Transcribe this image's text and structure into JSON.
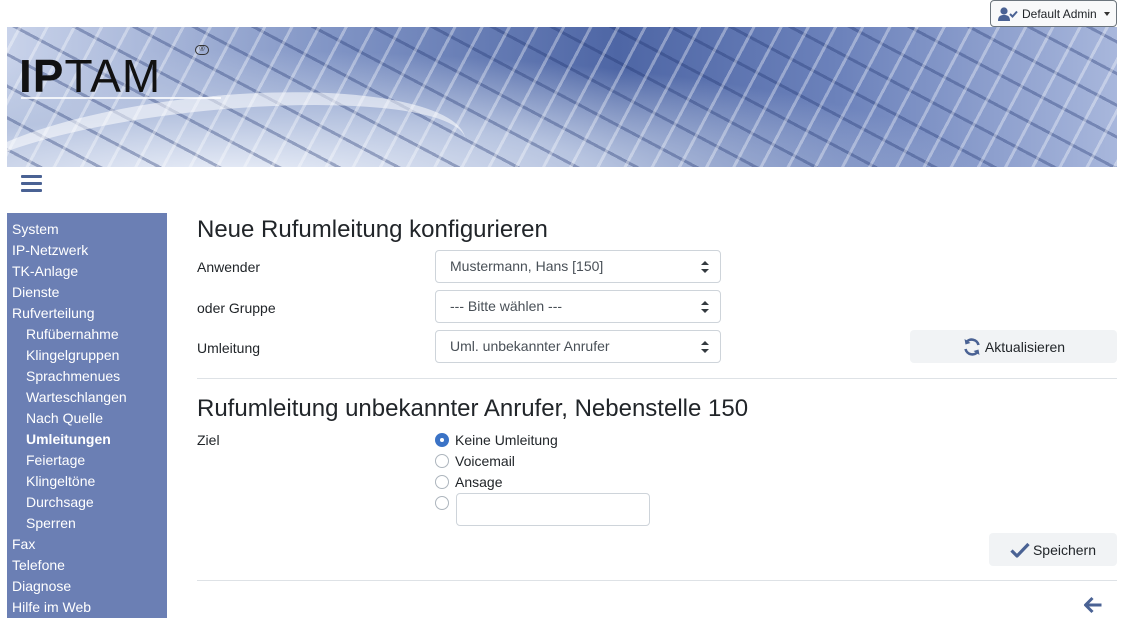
{
  "user_menu": {
    "label": "Default Admin"
  },
  "logo": {
    "text_bold": "IP",
    "text_rest": "TAM",
    "reg_mark": "®"
  },
  "sidebar": {
    "items": [
      {
        "label": "System",
        "level": 0
      },
      {
        "label": "IP-Netzwerk",
        "level": 0
      },
      {
        "label": "TK-Anlage",
        "level": 0
      },
      {
        "label": "Dienste",
        "level": 0
      },
      {
        "label": "Rufverteilung",
        "level": 0
      },
      {
        "label": "Rufübernahme",
        "level": 1
      },
      {
        "label": "Klingelgruppen",
        "level": 1
      },
      {
        "label": "Sprachmenues",
        "level": 1
      },
      {
        "label": "Warteschlangen",
        "level": 1
      },
      {
        "label": "Nach Quelle",
        "level": 1
      },
      {
        "label": "Umleitungen",
        "level": 1,
        "active": true
      },
      {
        "label": "Feiertage",
        "level": 1
      },
      {
        "label": "Klingeltöne",
        "level": 1
      },
      {
        "label": "Durchsage",
        "level": 1
      },
      {
        "label": "Sperren",
        "level": 1
      },
      {
        "label": "Fax",
        "level": 0
      },
      {
        "label": "Telefone",
        "level": 0
      },
      {
        "label": "Diagnose",
        "level": 0
      },
      {
        "label": "Hilfe im Web",
        "level": 0
      }
    ]
  },
  "config": {
    "title": "Neue Rufumleitung konfigurieren",
    "user_label": "Anwender",
    "user_value": "Mustermann, Hans [150]",
    "group_label": "oder Gruppe",
    "group_value": "--- Bitte wählen ---",
    "redirect_label": "Umleitung",
    "redirect_value": "Uml. unbekannter Anrufer",
    "refresh_label": "Aktualisieren"
  },
  "redirect": {
    "title": "Rufumleitung unbekannter Anrufer, Nebenstelle 150",
    "target_label": "Ziel",
    "options": [
      {
        "label": "Keine Umleitung",
        "checked": true
      },
      {
        "label": "Voicemail",
        "checked": false
      },
      {
        "label": "Ansage",
        "checked": false
      }
    ],
    "custom_value": "",
    "save_label": "Speichern"
  },
  "colors": {
    "sidebar": "#6b7fb4",
    "accent": "#3b73c6",
    "icon": "#4a6294"
  }
}
